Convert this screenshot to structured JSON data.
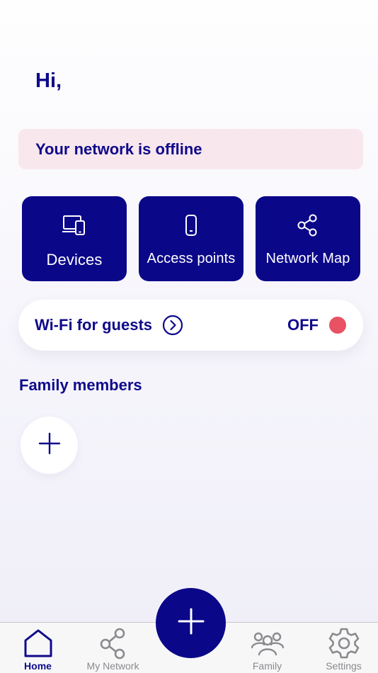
{
  "greeting": "Hi,",
  "banner": {
    "text": "Your network is offline"
  },
  "tiles": [
    {
      "label": "Devices",
      "icon": "devices-icon"
    },
    {
      "label": "Access points",
      "icon": "access-point-icon"
    },
    {
      "label": "Network Map",
      "icon": "share-icon"
    }
  ],
  "guest_wifi": {
    "label": "Wi-Fi for guests",
    "status": "OFF",
    "status_color": "#e85262"
  },
  "family": {
    "title": "Family members"
  },
  "tabbar": {
    "items": [
      {
        "label": "Home",
        "icon": "home-icon",
        "active": true
      },
      {
        "label": "My Network",
        "icon": "share-icon",
        "active": false
      },
      {
        "label": "Family",
        "icon": "family-icon",
        "active": false
      },
      {
        "label": "Settings",
        "icon": "gear-icon",
        "active": false
      }
    ]
  },
  "colors": {
    "primary": "#0b0789",
    "text": "#0f0a8a",
    "banner_bg": "#f8e8ee",
    "inactive": "#8a8a8e"
  }
}
